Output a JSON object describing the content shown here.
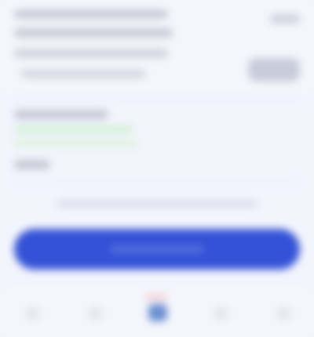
{
  "screen": {
    "header": {
      "title": "",
      "subtitle": "",
      "right_tag": "",
      "right_pill": ""
    },
    "details": {
      "row1_label": "",
      "row1_value": "",
      "row2_label": "",
      "row2_value": ""
    },
    "note": "",
    "cta_label": "",
    "nav": [
      {
        "label": "",
        "icon": "home-icon"
      },
      {
        "label": "",
        "icon": "list-icon"
      },
      {
        "label": "",
        "icon": "wallet-icon"
      },
      {
        "label": "",
        "icon": "bell-icon"
      },
      {
        "label": "",
        "icon": "user-icon"
      }
    ],
    "colors": {
      "accent": "#3452d6",
      "background": "#f3f5fd",
      "success_tint": "#d4efd8"
    }
  }
}
